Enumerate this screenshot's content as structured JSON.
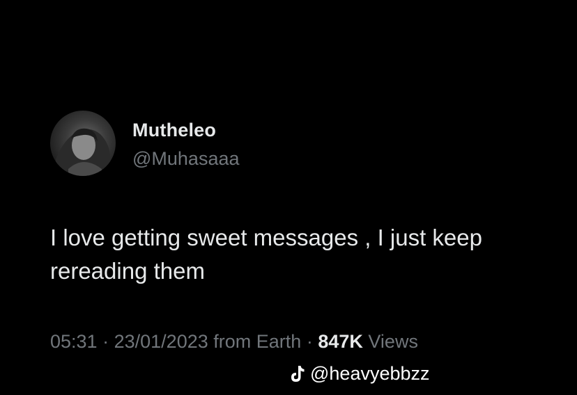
{
  "tweet": {
    "display_name": "Mutheleo",
    "handle": "@Muhasaaa",
    "text": "I love getting sweet messages , I just keep rereading them",
    "time": "05:31",
    "separator": "·",
    "date": "23/01/2023",
    "source": "from Earth",
    "views_count": "847K",
    "views_label": "Views"
  },
  "watermark": {
    "icon": "tiktok-icon",
    "handle": "@heavyebbzz"
  },
  "colors": {
    "background": "#000000",
    "primary_text": "#e7e9ea",
    "secondary_text": "#71767b"
  }
}
